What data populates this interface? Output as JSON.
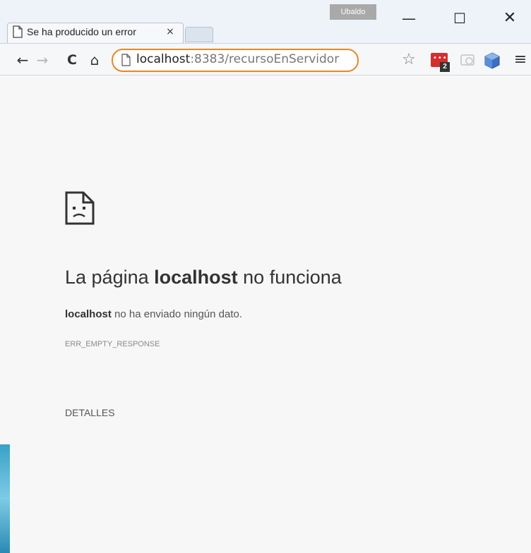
{
  "window": {
    "user_badge": "Ubaldo",
    "minimize_glyph": "—",
    "maximize_glyph": "☐",
    "close_glyph": "✕"
  },
  "tabs": [
    {
      "title": "Se ha producido un error",
      "close_glyph": "×",
      "icon": "page-icon"
    }
  ],
  "toolbar": {
    "back_glyph": "←",
    "forward_glyph": "→",
    "reload_glyph": "C",
    "home_glyph": "⌂",
    "url_host": "localhost",
    "url_path": ":8383/recursoEnServidor",
    "star_glyph": "☆",
    "extension_badge": "2",
    "menu_glyph": "≡",
    "omnibox_highlight_color": "#e8872a"
  },
  "error_page": {
    "heading_prefix": "La página ",
    "heading_host": "localhost",
    "heading_suffix": " no funciona",
    "message_host": "localhost",
    "message_rest": " no ha enviado ningún dato.",
    "error_code": "ERR_EMPTY_RESPONSE",
    "details_label": "DETALLES"
  }
}
